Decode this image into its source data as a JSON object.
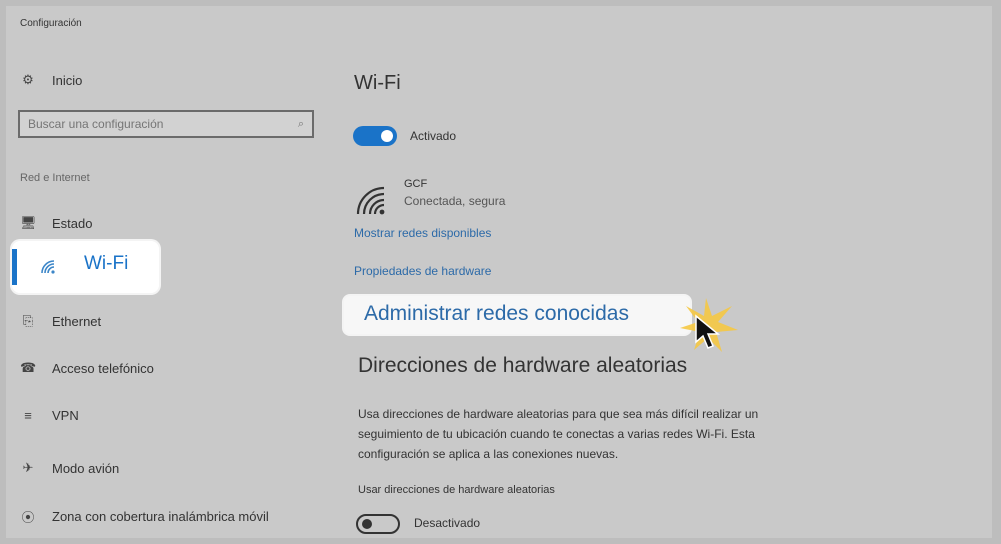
{
  "window": {
    "title": "Configuración"
  },
  "sidebar": {
    "home": {
      "label": "Inicio",
      "icon": "gear-icon"
    },
    "search": {
      "placeholder": "Buscar una configuración",
      "icon": "search-icon"
    },
    "section_label": "Red e Internet",
    "items": [
      {
        "label": "Estado",
        "icon": "status-icon"
      },
      {
        "label": "Wi-Fi",
        "icon": "wifi-icon",
        "selected": true
      },
      {
        "label": "Ethernet",
        "icon": "ethernet-icon"
      },
      {
        "label": "Acceso telefónico",
        "icon": "dialup-icon"
      },
      {
        "label": "VPN",
        "icon": "vpn-icon"
      },
      {
        "label": "Modo avión",
        "icon": "airplane-icon"
      },
      {
        "label": "Zona con cobertura inalámbrica móvil",
        "icon": "hotspot-icon"
      }
    ]
  },
  "main": {
    "title": "Wi-Fi",
    "wifi_toggle": {
      "state_label": "Activado",
      "on": true
    },
    "network": {
      "name": "GCF",
      "status": "Conectada, segura"
    },
    "links": {
      "show_networks": "Mostrar redes disponibles",
      "hardware_properties": "Propiedades de hardware",
      "manage_known": "Administrar redes conocidas"
    },
    "random_hw": {
      "heading": "Direcciones de hardware aleatorias",
      "description": "Usa direcciones de hardware aleatorias para que sea más difícil realizar un seguimiento de tu ubicación cuando te conectas a varias redes Wi-Fi. Esta configuración se aplica a las conexiones nuevas.",
      "option_label": "Usar direcciones de hardware aleatorias",
      "toggle_label": "Desactivado",
      "on": false
    }
  },
  "colors": {
    "accent": "#1a73c8",
    "link": "#2c6aa8",
    "background": "#c9c9c9"
  }
}
